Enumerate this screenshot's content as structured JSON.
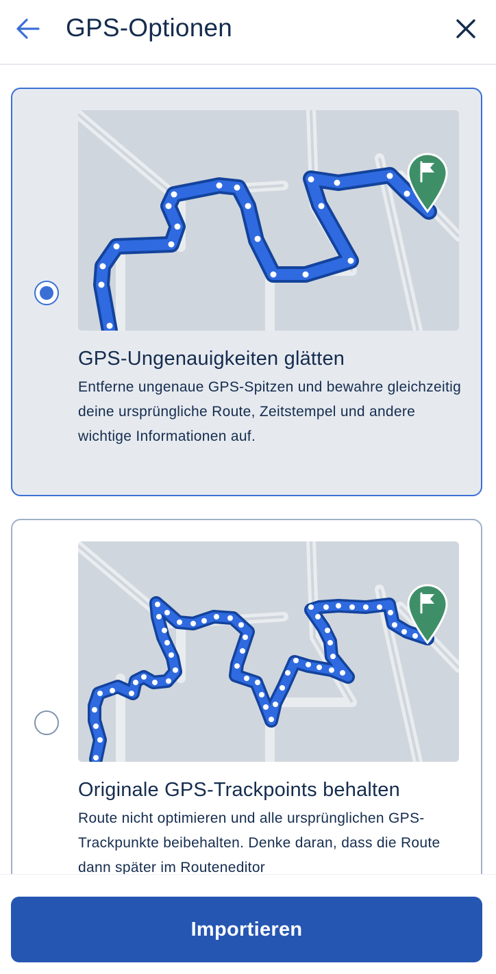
{
  "header": {
    "title": "GPS-Optionen",
    "back_icon": "arrow-left-icon",
    "close_icon": "close-icon"
  },
  "options": [
    {
      "selected": true,
      "title": "GPS-Ungenauigkeiten glätten",
      "description": "Entferne ungenaue GPS-Spitzen und bewahre gleichzeitig deine ursprüngliche Route, Zeitstempel und andere wichtige Informationen auf.",
      "map_icon": "finish-flag-pin-icon"
    },
    {
      "selected": false,
      "title": "Originale GPS-Trackpoints behalten",
      "description": "Route nicht optimieren und alle ursprünglichen GPS-Trackpunkte beibehalten. Denke daran, dass die Route dann später im Routeneditor",
      "map_icon": "finish-flag-pin-icon"
    }
  ],
  "footer": {
    "import_label": "Importieren"
  },
  "colors": {
    "accent": "#3a6fd6",
    "button": "#2556b2",
    "route": "#2f6ae0",
    "pin": "#3e8f68",
    "text": "#152c4e"
  }
}
